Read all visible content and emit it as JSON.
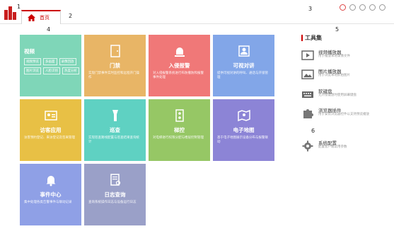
{
  "annotations": {
    "n1": "1",
    "n2": "2",
    "n3": "3",
    "n4": "4",
    "n5": "5",
    "n6": "6"
  },
  "top": {
    "tab_home": "首页",
    "icons": [
      "refresh-icon",
      "user-icon",
      "info-icon",
      "minimize-icon",
      "close-icon"
    ]
  },
  "tiles": [
    {
      "title": "视频",
      "color": "#7fd6b8",
      "icon": "video-icon",
      "sub": [
        "视频预览",
        "多画面",
        "录像回放",
        "图片浏览",
        "人脸识别",
        "热度分析"
      ]
    },
    {
      "title": "门禁",
      "color": "#e8b566",
      "icon": "door-icon",
      "desc": "实现门禁事件实时监控和远程开门操作"
    },
    {
      "title": "入侵报警",
      "color": "#f07878",
      "icon": "alarm-icon",
      "desc": "对入侵报警系统进行布防撤防和报警事件处理"
    },
    {
      "title": "可视对讲",
      "color": "#82a6e8",
      "icon": "intercom-icon",
      "desc": "提供可视对讲的呼叫、通话与开锁管理"
    },
    {
      "title": "访客应用",
      "color": "#e8c045",
      "icon": "visitor-icon",
      "desc": "访客预约登记、来访登记及签离管理"
    },
    {
      "title": "巡查",
      "color": "#5fd1c2",
      "icon": "patrol-icon",
      "desc": "实现巡查路线配置与巡查结果查询统计"
    },
    {
      "title": "梯控",
      "color": "#96c765",
      "icon": "elevator-icon",
      "desc": "对电梯进行权限分配与楼层控制管理"
    },
    {
      "title": "电子地图",
      "color": "#8c84d6",
      "icon": "map-icon",
      "desc": "基于电子地图展示设备分布与报警联动"
    },
    {
      "title": "事件中心",
      "color": "#8fa0e6",
      "icon": "bell-icon",
      "desc": "集中处理各类告警事件与联动记录"
    },
    {
      "title": "日志查询",
      "color": "#9aa0c8",
      "icon": "log-icon",
      "desc": "查询系统操作日志与设备运行日志"
    }
  ],
  "toolbox": {
    "title": "工具集",
    "items": [
      {
        "name": "视频播放器",
        "desc": "用于播放本地录像文件",
        "icon": "video-player-icon"
      },
      {
        "name": "图片播放器",
        "desc": "用于浏览本地抓拍图片",
        "icon": "image-viewer-icon"
      },
      {
        "name": "软键盘",
        "desc": "无外接键盘时使用屏幕键盘",
        "icon": "keyboard-icon"
      },
      {
        "name": "浏览器插件",
        "desc": "用于安装浏览器控件以支持预览播放",
        "icon": "plugin-icon"
      },
      {
        "name": "系统配置",
        "desc": "配置客户端常用参数",
        "icon": "settings-icon"
      }
    ]
  }
}
